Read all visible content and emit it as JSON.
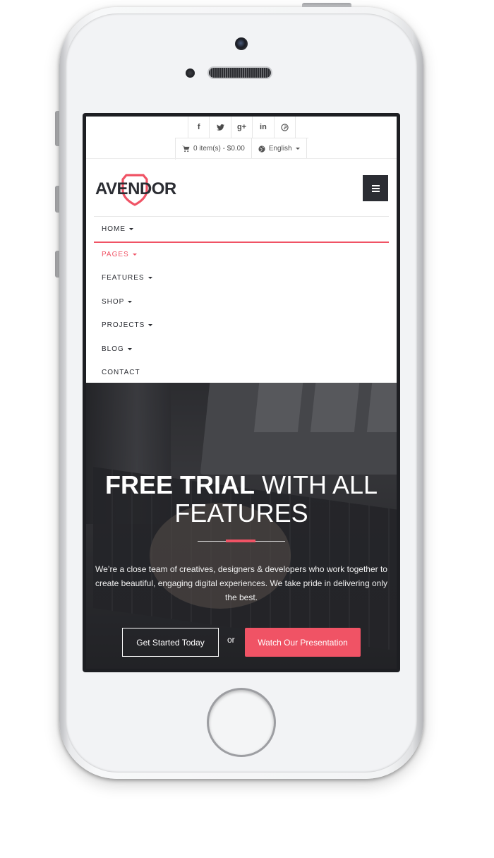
{
  "social": {
    "icons": [
      "facebook-icon",
      "twitter-icon",
      "google-plus-icon",
      "linkedin-icon",
      "pinterest-icon"
    ],
    "labels": [
      "f",
      "t",
      "g+",
      "in",
      "p"
    ]
  },
  "topbar": {
    "cart_text": "0 item(s) - $0.00",
    "language": "English"
  },
  "brand": {
    "logo_text": "AVENDOR",
    "accent_color": "#f05365"
  },
  "nav": {
    "items": [
      {
        "label": "HOME",
        "has_dropdown": true
      },
      {
        "label": "PAGES",
        "has_dropdown": true,
        "active": true
      },
      {
        "label": "FEATURES",
        "has_dropdown": true
      },
      {
        "label": "SHOP",
        "has_dropdown": true
      },
      {
        "label": "PROJECTS",
        "has_dropdown": true
      },
      {
        "label": "BLOG",
        "has_dropdown": true
      },
      {
        "label": "CONTACT",
        "has_dropdown": false
      }
    ]
  },
  "hero": {
    "title_bold": "FREE TRIAL",
    "title_light_1": "WITH ALL",
    "title_light_2": "FEATURES",
    "text": "We’re a close team of creatives, designers & developers who work together to create beautiful, engaging digital experiences. We take pride in delivering only the best.",
    "primary_button": "Get Started Today",
    "or_text": "or",
    "secondary_button": "Watch Our Presentation"
  }
}
